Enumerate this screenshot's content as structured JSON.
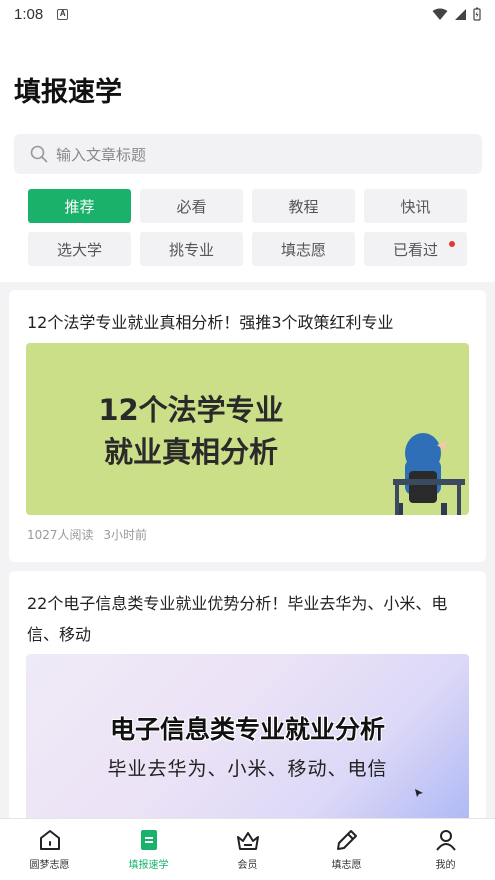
{
  "status_bar": {
    "time": "1:08",
    "notif_letter": "A"
  },
  "header": {
    "title": "填报速学"
  },
  "search": {
    "placeholder": "输入文章标题"
  },
  "categories": [
    {
      "label": "推荐",
      "active": true
    },
    {
      "label": "必看"
    },
    {
      "label": "教程"
    },
    {
      "label": "快讯"
    },
    {
      "label": "选大学"
    },
    {
      "label": "挑专业"
    },
    {
      "label": "填志愿"
    },
    {
      "label": "已看过",
      "has_dot": true
    }
  ],
  "articles": [
    {
      "title": "12个法学专业就业真相分析！强推3个政策红利专业",
      "image_line1": "12个法学专业",
      "image_line2": "就业真相分析",
      "reads": "1027人阅读",
      "time": "3小时前"
    },
    {
      "title": "22个电子信息类专业就业优势分析！毕业去华为、小米、电信、移动",
      "image_line1": "电子信息类专业就业分析",
      "image_line2": "毕业去华为、小米、移动、电信"
    }
  ],
  "tabbar": [
    {
      "label": "圆梦志愿",
      "icon": "home-icon"
    },
    {
      "label": "填报速学",
      "icon": "book-icon",
      "active": true
    },
    {
      "label": "会员",
      "icon": "crown-icon"
    },
    {
      "label": "填志愿",
      "icon": "pencil-icon"
    },
    {
      "label": "我的",
      "icon": "user-icon"
    }
  ],
  "colors": {
    "accent": "#1ab26b",
    "dot": "#e53935"
  }
}
